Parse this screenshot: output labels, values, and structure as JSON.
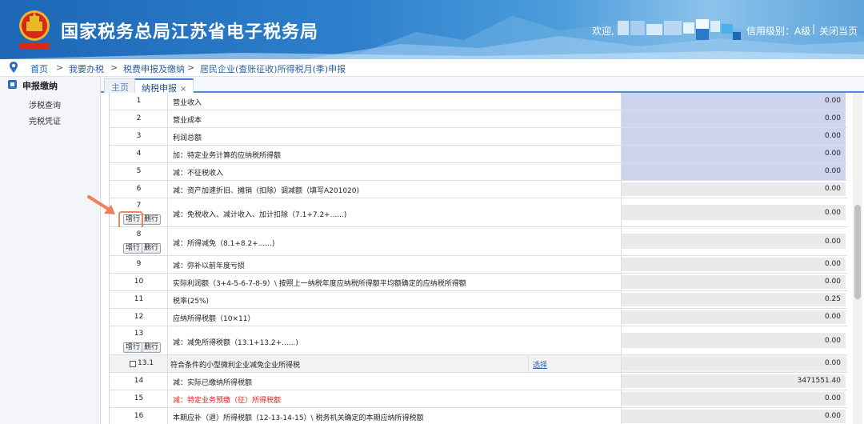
{
  "header": {
    "title": "国家税务总局江苏省电子税务局",
    "welcome": "欢迎,",
    "credit_level": "信用级别：A级",
    "separator": "|",
    "close_page": "关闭当页",
    "colors": {
      "bg_start": "#1d67b6",
      "bg_end": "#8cc3ec",
      "emblem_red": "#d9281b",
      "emblem_gold": "#e9b928"
    }
  },
  "breadcrumb": {
    "items": [
      "首页",
      "我要办税",
      "税费申报及缴纳",
      "居民企业(查账征收)所得税月(季)申报"
    ],
    "arrow": ">"
  },
  "sidebar": {
    "header": "申报缴纳",
    "items": [
      "涉税查询",
      "完税凭证"
    ]
  },
  "tabs": [
    {
      "label": "主页",
      "active": false
    },
    {
      "label": "纳税申报",
      "active": true,
      "close": "×"
    }
  ],
  "buttons": {
    "add_row": "增行",
    "delete_row": "删行",
    "select": "选择"
  },
  "rows": [
    {
      "no": "1",
      "desc": "营业收入",
      "value": "0.00",
      "cell": "blue"
    },
    {
      "no": "2",
      "desc": "营业成本",
      "value": "0.00",
      "cell": "blue"
    },
    {
      "no": "3",
      "desc": "利润总额",
      "value": "0.00",
      "cell": "blue"
    },
    {
      "no": "4",
      "desc": "加：特定业务计算的应纳税所得额",
      "value": "0.00",
      "cell": "blue"
    },
    {
      "no": "5",
      "desc": "减：不征税收入",
      "value": "0.00",
      "cell": "blue"
    },
    {
      "no": "6",
      "desc": "减：资产加速折旧、摊销（扣除）调减额（填写A201020)",
      "value": "0.00",
      "cell": "gray"
    },
    {
      "no": "7",
      "desc": "减：免税收入、减计收入、加计扣除（7.1+7.2+......)",
      "value": "0.00",
      "cell": "gray"
    },
    {
      "no": "8",
      "desc": "减：所得减免（8.1+8.2+......)",
      "value": "0.00",
      "cell": "gray"
    },
    {
      "no": "9",
      "desc": "减：弥补以前年度亏损",
      "value": "0.00",
      "cell": "gray"
    },
    {
      "no": "10",
      "desc": "实际利润额（3+4-5-6-7-8-9）\\ 按照上一纳税年度应纳税所得额平均额确定的应纳税所得额",
      "value": "0.00",
      "cell": "gray"
    },
    {
      "no": "11",
      "desc": "税率(25%)",
      "value": "0.25",
      "cell": "gray"
    },
    {
      "no": "12",
      "desc": "应纳所得税额（10×11）",
      "value": "0.00",
      "cell": "gray"
    },
    {
      "no": "13",
      "desc": "减：减免所得税额（13.1+13.2+......)",
      "value": "0.00",
      "cell": "gray"
    },
    {
      "no": "13.1",
      "desc": "符合条件的小型微利企业减免企业所得税",
      "value": "0.00",
      "cell": "gray"
    },
    {
      "no": "14",
      "desc": "减：实际已缴纳所得税额",
      "value": "3471551.40",
      "cell": "gray"
    },
    {
      "no": "15",
      "desc": "减：特定业务预缴（征）所得税额",
      "value": "0.00",
      "cell": "gray"
    },
    {
      "no": "16",
      "desc": "本期应补（退）所得税额（12-13-14-15）\\ 税务机关确定的本期应纳所得税额",
      "value": "0.00",
      "cell": "gray"
    }
  ]
}
